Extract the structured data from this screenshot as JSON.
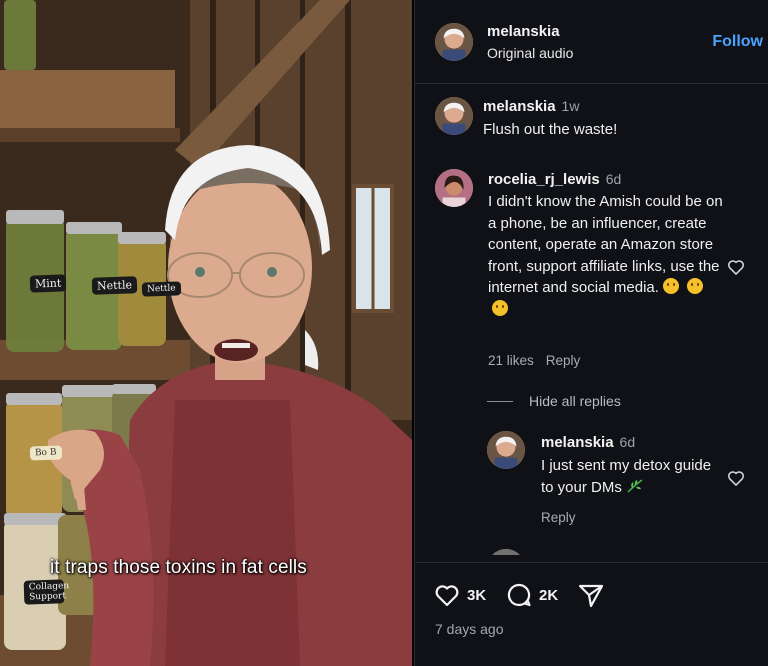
{
  "post": {
    "author": "melanskia",
    "audio": "Original audio",
    "follow_label": "Follow",
    "caption_overlay": "it traps those toxins in fat cells",
    "jar_labels": [
      "Mint",
      "Nettle",
      "Nettle",
      "Bo B",
      "Collagen Support"
    ]
  },
  "comments": [
    {
      "user": "melanskia",
      "time": "1w",
      "text": "Flush out the waste!"
    },
    {
      "user": "rocelia_rj_lewis",
      "time": "6d",
      "text": "I didn't know the Amish could be on a phone, be an influencer, create content, operate an Amazon store front, support affiliate links, use the internet and social media.",
      "likes": "21 likes",
      "reply_label": "Reply",
      "hide_replies": "Hide all replies",
      "replies": [
        {
          "user": "melanskia",
          "time": "6d",
          "text": "I just sent my detox guide to your DMs",
          "reply_label": "Reply"
        }
      ]
    }
  ],
  "footer": {
    "likes": "3K",
    "comments": "2K",
    "date": "7 days ago"
  },
  "colors": {
    "panel_bg": "#0f1116",
    "accent": "#4aa3ff",
    "muted": "#a8acb3"
  }
}
